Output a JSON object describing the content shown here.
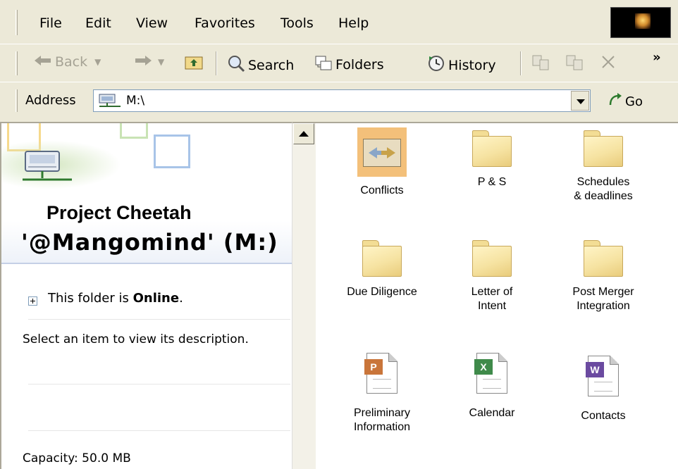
{
  "menu": [
    "File",
    "Edit",
    "View",
    "Favorites",
    "Tools",
    "Help"
  ],
  "toolbar": {
    "back": "Back",
    "search": "Search",
    "folders": "Folders",
    "history": "History",
    "chevron": "»"
  },
  "address": {
    "label": "Address",
    "value": "M:\\",
    "go": "Go"
  },
  "left_pane": {
    "title_line1": "Project Cheetah",
    "title_line2": "'@Mangomind' (M:)",
    "online_prefix": "This folder is ",
    "online_status": "Online",
    "online_suffix": ".",
    "description": "Select an item to view its description.",
    "capacity": "Capacity: 50.0 MB"
  },
  "items": [
    {
      "label": "Conflicts",
      "icon": "conflicts-folder-icon"
    },
    {
      "label": "P & S",
      "icon": "folder-icon"
    },
    {
      "label": "Schedules\n& deadlines",
      "icon": "folder-icon"
    },
    {
      "label": "Due Diligence",
      "icon": "folder-icon"
    },
    {
      "label": "Letter of\nIntent",
      "icon": "folder-icon"
    },
    {
      "label": "Post Merger\nIntegration",
      "icon": "folder-icon"
    },
    {
      "label": "Preliminary\nInformation",
      "icon": "powerpoint-document-icon"
    },
    {
      "label": "Calendar",
      "icon": "excel-document-icon"
    },
    {
      "label": "Contacts",
      "icon": "word-document-icon"
    }
  ],
  "colors": {
    "chrome": "#ece9d8",
    "folder": "#f6e3a2",
    "powerpoint": "#c9753a",
    "excel": "#3f8a4a",
    "word": "#6b4aa0"
  }
}
